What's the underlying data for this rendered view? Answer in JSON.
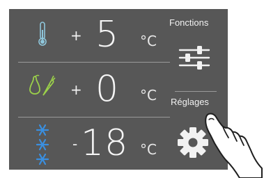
{
  "compartments": [
    {
      "name": "refrigerator",
      "icon": "thermometer-icon",
      "sign": "+",
      "value": "5",
      "unit": "°C"
    },
    {
      "name": "fresh-produce",
      "icon": "pear-carrot-icon",
      "sign": "+",
      "value": "0",
      "unit": "°C"
    },
    {
      "name": "freezer",
      "icon": "snowflakes-icon",
      "sign": "-",
      "value": "18",
      "unit": "°C"
    }
  ],
  "sidebar": {
    "functions_label": "Fonctions",
    "functions_icon": "sliders-icon",
    "settings_label": "Réglages",
    "settings_icon": "gear-icon"
  },
  "colors": {
    "panel": "#575757",
    "text": "#f2f2f2",
    "thermometer": "#8fc7dc",
    "produce": "#9bd04a",
    "snowflake": "#3a8fe0"
  }
}
